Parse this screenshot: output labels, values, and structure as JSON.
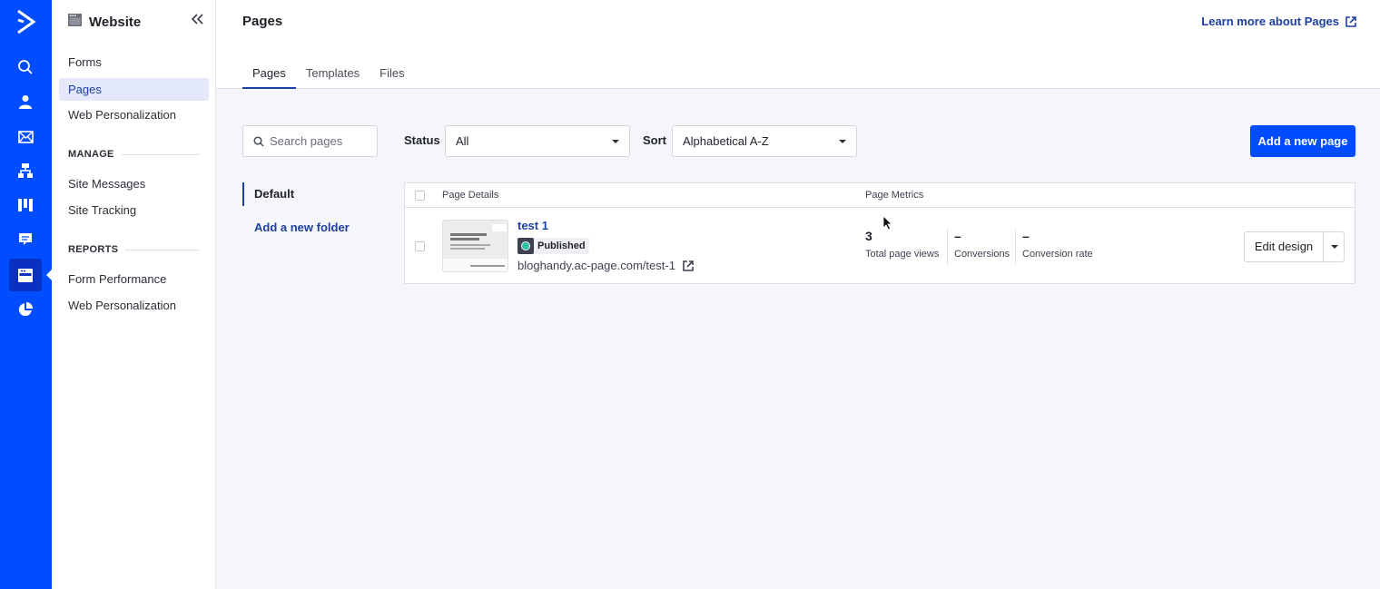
{
  "rail": {
    "logo_icon": "activecampaign-chevron-logo",
    "items": [
      {
        "icon": "search-icon",
        "label": "Search"
      },
      {
        "icon": "contacts-icon",
        "label": "Contacts"
      },
      {
        "icon": "campaigns-icon",
        "label": "Campaigns"
      },
      {
        "icon": "automations-icon",
        "label": "Automations"
      },
      {
        "icon": "deals-icon",
        "label": "Deals"
      },
      {
        "icon": "conversations-icon",
        "label": "Conversations"
      },
      {
        "icon": "website-icon",
        "label": "Website",
        "active": true
      },
      {
        "icon": "reports-icon",
        "label": "Reports"
      }
    ]
  },
  "sidebar": {
    "title": "Website",
    "collapse_icon": "double-chevron-left-icon",
    "items": [
      {
        "label": "Forms"
      },
      {
        "label": "Pages",
        "active": true
      },
      {
        "label": "Web Personalization"
      }
    ],
    "manage": {
      "heading": "MANAGE",
      "items": [
        {
          "label": "Site Messages"
        },
        {
          "label": "Site Tracking"
        }
      ]
    },
    "reports": {
      "heading": "REPORTS",
      "items": [
        {
          "label": "Form Performance"
        },
        {
          "label": "Web Personalization"
        }
      ]
    }
  },
  "header": {
    "title": "Pages",
    "learn_more": "Learn more about Pages",
    "tabs": [
      {
        "label": "Pages",
        "active": true
      },
      {
        "label": "Templates"
      },
      {
        "label": "Files"
      }
    ]
  },
  "filters": {
    "search_placeholder": "Search pages",
    "search_value": "",
    "status_label": "Status",
    "status_value": "All",
    "sort_label": "Sort",
    "sort_value": "Alphabetical A-Z",
    "add_page_label": "Add a new page"
  },
  "folders": {
    "items": [
      {
        "label": "Default",
        "active": true
      }
    ],
    "add_label": "Add a new folder"
  },
  "table": {
    "columns": [
      "Page Details",
      "Page Metrics"
    ],
    "rows": [
      {
        "name": "test 1",
        "status": "Published",
        "url": "bloghandy.ac-page.com/test-1",
        "metrics": [
          {
            "value": "3",
            "label": "Total page views"
          },
          {
            "value": "–",
            "label": "Conversions"
          },
          {
            "value": "–",
            "label": "Conversion rate"
          }
        ],
        "action_label": "Edit design"
      }
    ]
  },
  "colors": {
    "brand_blue": "#004cff",
    "rail_active": "#0a30c2",
    "link_blue": "#1d3fa3",
    "published_green": "#2ebfa5"
  }
}
